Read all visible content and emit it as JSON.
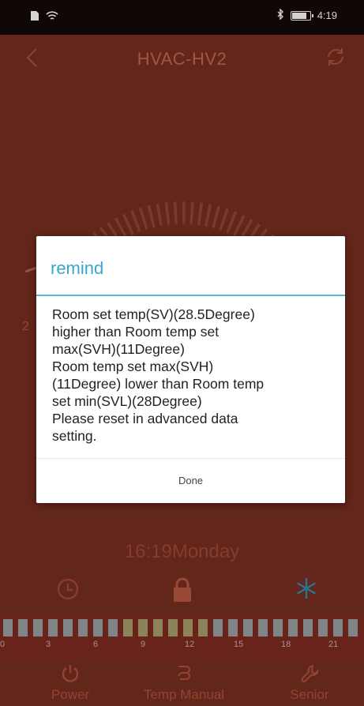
{
  "app": {
    "title": "HVAC-HV2"
  },
  "status_bar": {
    "time": "4:19"
  },
  "dial": {
    "side_value": "2"
  },
  "dialog": {
    "title": "remind",
    "message_lines": [
      "Room set temp(SV)(28.5Degree)",
      "higher than Room temp set",
      "max(SVH)(11Degree)",
      "Room temp set max(SVH)",
      "(11Degree) lower than Room temp",
      "set min(SVL)(28Degree)",
      "Please reset in advanced data",
      "setting."
    ],
    "button_label": "Done"
  },
  "clock": {
    "text": "16:19Monday"
  },
  "schedule": {
    "hour_labels": [
      "0",
      "3",
      "6",
      "9",
      "12",
      "15",
      "18",
      "21"
    ]
  },
  "nav": {
    "items": [
      {
        "label": "Power",
        "icon": "power-icon"
      },
      {
        "label": "Temp Manual",
        "icon": "hand-icon"
      },
      {
        "label": "Senior",
        "icon": "wrench-icon"
      }
    ]
  },
  "colors": {
    "background": "#742f22",
    "dialog_title": "#3aa7c9",
    "accent_snowflake": "#2c8fb0"
  }
}
